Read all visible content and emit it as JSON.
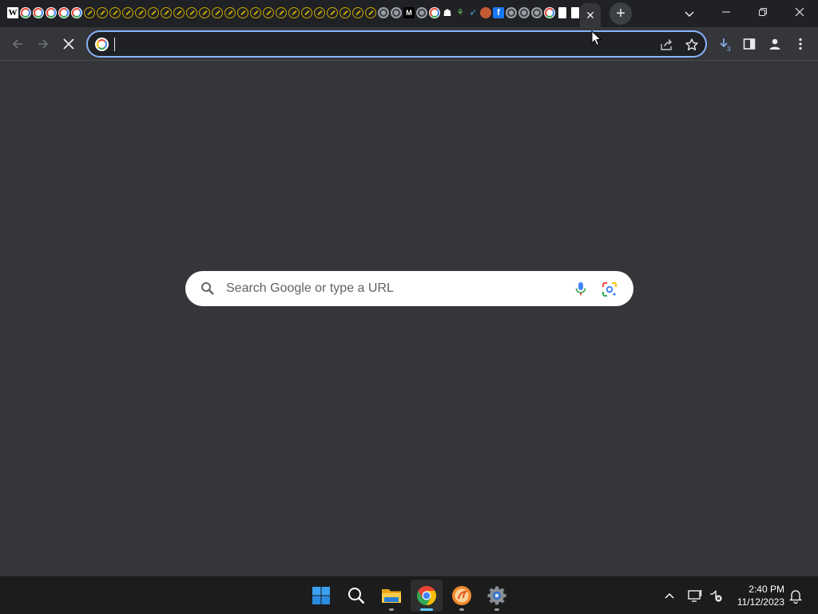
{
  "tabstrip": {
    "pinned_tabs": [
      {
        "icon": "wikipedia-icon",
        "letter": "W"
      },
      {
        "icon": "google-icon"
      },
      {
        "icon": "google-icon"
      },
      {
        "icon": "google-icon"
      },
      {
        "icon": "google-icon"
      },
      {
        "icon": "google-icon"
      },
      {
        "icon": "gold-link-icon"
      },
      {
        "icon": "gold-link-icon"
      },
      {
        "icon": "gold-link-icon"
      },
      {
        "icon": "gold-link-icon"
      },
      {
        "icon": "gold-link-icon"
      },
      {
        "icon": "gold-link-icon"
      },
      {
        "icon": "gold-link-icon"
      },
      {
        "icon": "gold-link-icon"
      },
      {
        "icon": "gold-link-icon"
      },
      {
        "icon": "gold-link-icon"
      },
      {
        "icon": "gold-link-icon"
      },
      {
        "icon": "gold-link-icon"
      },
      {
        "icon": "gold-link-icon"
      },
      {
        "icon": "gold-link-icon"
      },
      {
        "icon": "gold-link-icon"
      },
      {
        "icon": "gold-link-icon"
      },
      {
        "icon": "gold-link-icon"
      },
      {
        "icon": "gold-link-icon"
      },
      {
        "icon": "gold-link-icon"
      },
      {
        "icon": "gold-link-icon"
      },
      {
        "icon": "gold-link-icon"
      },
      {
        "icon": "gold-link-icon"
      },
      {
        "icon": "gold-link-icon"
      },
      {
        "icon": "grey-globe-icon"
      },
      {
        "icon": "grey-globe-icon"
      },
      {
        "icon": "m-logo-icon",
        "letter": "M"
      },
      {
        "icon": "grey-globe-icon"
      },
      {
        "icon": "google-icon"
      },
      {
        "icon": "snapchat-icon",
        "letter": "☗"
      },
      {
        "icon": "green-leaf-icon",
        "letter": "⚘"
      },
      {
        "icon": "blue-arrow-icon",
        "letter": "➶"
      },
      {
        "icon": "orange-circle-icon"
      },
      {
        "icon": "facebook-icon",
        "letter": "f"
      },
      {
        "icon": "grey-globe-icon"
      },
      {
        "icon": "grey-globe-icon"
      },
      {
        "icon": "grey-globe-icon"
      },
      {
        "icon": "google-icon"
      },
      {
        "icon": "white-page-icon"
      },
      {
        "icon": "white-page-icon"
      }
    ],
    "active_tab_close": "✕",
    "new_tab": "+"
  },
  "toolbar": {
    "address_value": "",
    "download_count": "3"
  },
  "content": {
    "search_placeholder": "Search Google or type a URL"
  },
  "taskbar": {
    "apps": [
      "start-button",
      "search-button",
      "file-explorer",
      "google-chrome",
      "orange-app",
      "settings"
    ],
    "time": "2:40 PM",
    "date": "11/12/2023"
  },
  "colors": {
    "tabstrip_bg": "#202124",
    "toolbar_bg": "#35363a",
    "page_bg": "#35363a",
    "omnibox_focus": "#8ab4f8",
    "taskbar_bg": "#1c1c1c",
    "chrome_active_indicator": "#60cdff"
  }
}
